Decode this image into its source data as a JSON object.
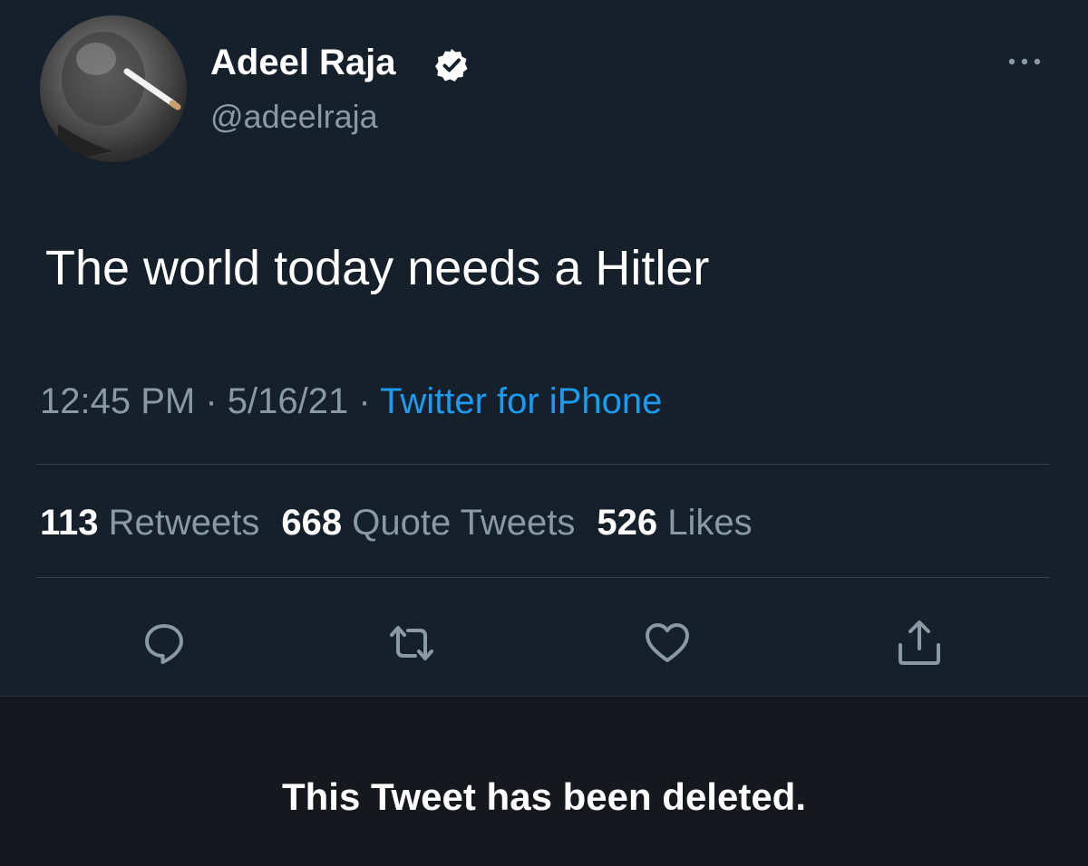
{
  "tweet": {
    "author": {
      "display_name": "Adeel Raja",
      "handle": "@adeelraja",
      "verified": true,
      "avatar_icon": "profile-photo"
    },
    "text": "The world today needs a Hitler",
    "time": "12:45 PM",
    "separator": "·",
    "date": "5/16/21",
    "source": "Twitter for iPhone",
    "stats": {
      "retweets_count": "113",
      "retweets_label": "Retweets",
      "quote_tweets_count": "668",
      "quote_tweets_label": "Quote Tweets",
      "likes_count": "526",
      "likes_label": "Likes"
    },
    "actions": [
      "reply-icon",
      "retweet-icon",
      "like-icon",
      "share-icon"
    ]
  },
  "banner": {
    "message": "This Tweet has been deleted."
  },
  "colors": {
    "background": "#15202b",
    "primary_text": "#ffffff",
    "secondary_text": "#8b98a5",
    "link": "#1d9bf0",
    "divider": "#38444d",
    "banner_background": "#15181c"
  }
}
